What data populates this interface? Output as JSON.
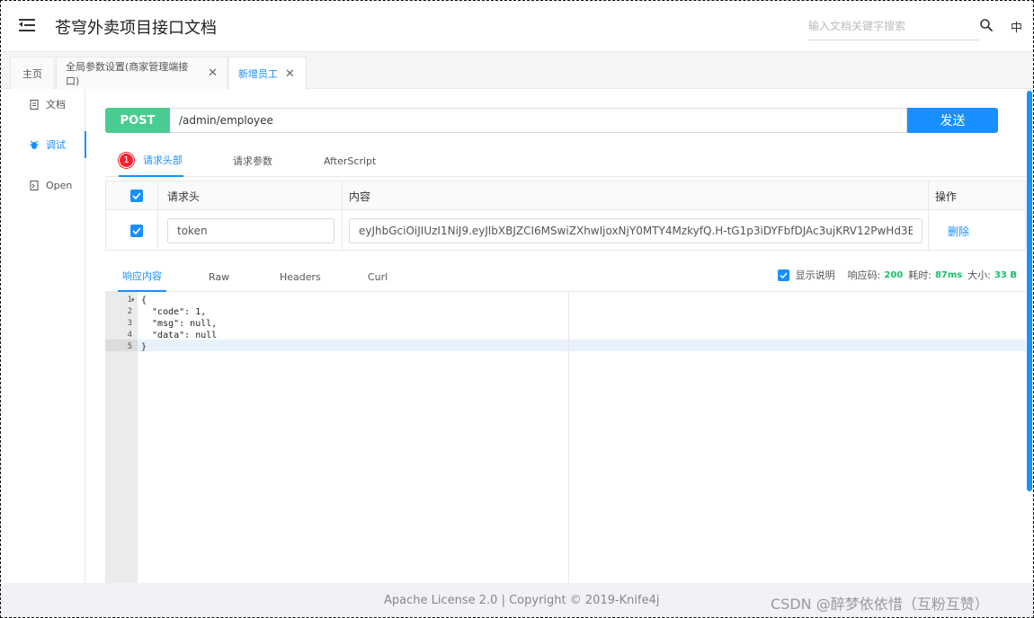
{
  "header": {
    "title": "苍穹外卖项目接口文档",
    "search_placeholder": "输入文档关键字搜索",
    "lang": "中"
  },
  "tabs": [
    {
      "label": "主页",
      "closable": false
    },
    {
      "label": "全局参数设置(商家管理端接口)",
      "closable": true
    },
    {
      "label": "新增员工",
      "closable": true,
      "active": true
    }
  ],
  "sidebar": {
    "items": [
      {
        "label": "文档",
        "icon": "file-icon"
      },
      {
        "label": "调试",
        "icon": "debug-icon",
        "active": true
      },
      {
        "label": "Open",
        "icon": "open-icon"
      }
    ]
  },
  "request": {
    "method": "POST",
    "url": "/admin/employee",
    "send_label": "发送",
    "method_color": "#49cc90",
    "accent_color": "#1890ff"
  },
  "request_tabs": {
    "headers_badge": "1",
    "headers": "请求头部",
    "params": "请求参数",
    "after_script": "AfterScript"
  },
  "header_table": {
    "col_header": "请求头",
    "col_content": "内容",
    "col_action": "操作",
    "rows": [
      {
        "key": "token",
        "value": "eyJhbGciOiJIUzI1NiJ9.eyJlbXBJZCI6MSwiZXhwIjoxNjY0MTY4MzkyfQ.H-tG1p3iDYFbfDJAc3ujKRV12PwHd3E",
        "delete_label": "删除"
      }
    ]
  },
  "response_tabs": {
    "content": "响应内容",
    "raw": "Raw",
    "headers": "Headers",
    "curl": "Curl"
  },
  "response_meta": {
    "show_desc": "显示说明",
    "code_label": "响应码:",
    "code_value": "200",
    "time_label": "耗时:",
    "time_value": "87ms",
    "size_label": "大小:",
    "size_value": "33 B"
  },
  "response_body": {
    "line_numbers": [
      "1",
      "2",
      "3",
      "4",
      "5"
    ],
    "lines": [
      "{",
      "  \"code\": 1,",
      "  \"msg\": null,",
      "  \"data\": null",
      "}"
    ]
  },
  "footer": {
    "text": "Apache License 2.0 | Copyright © 2019-Knife4j",
    "watermark": "CSDN @醉梦依依惜（互粉互赞）"
  }
}
